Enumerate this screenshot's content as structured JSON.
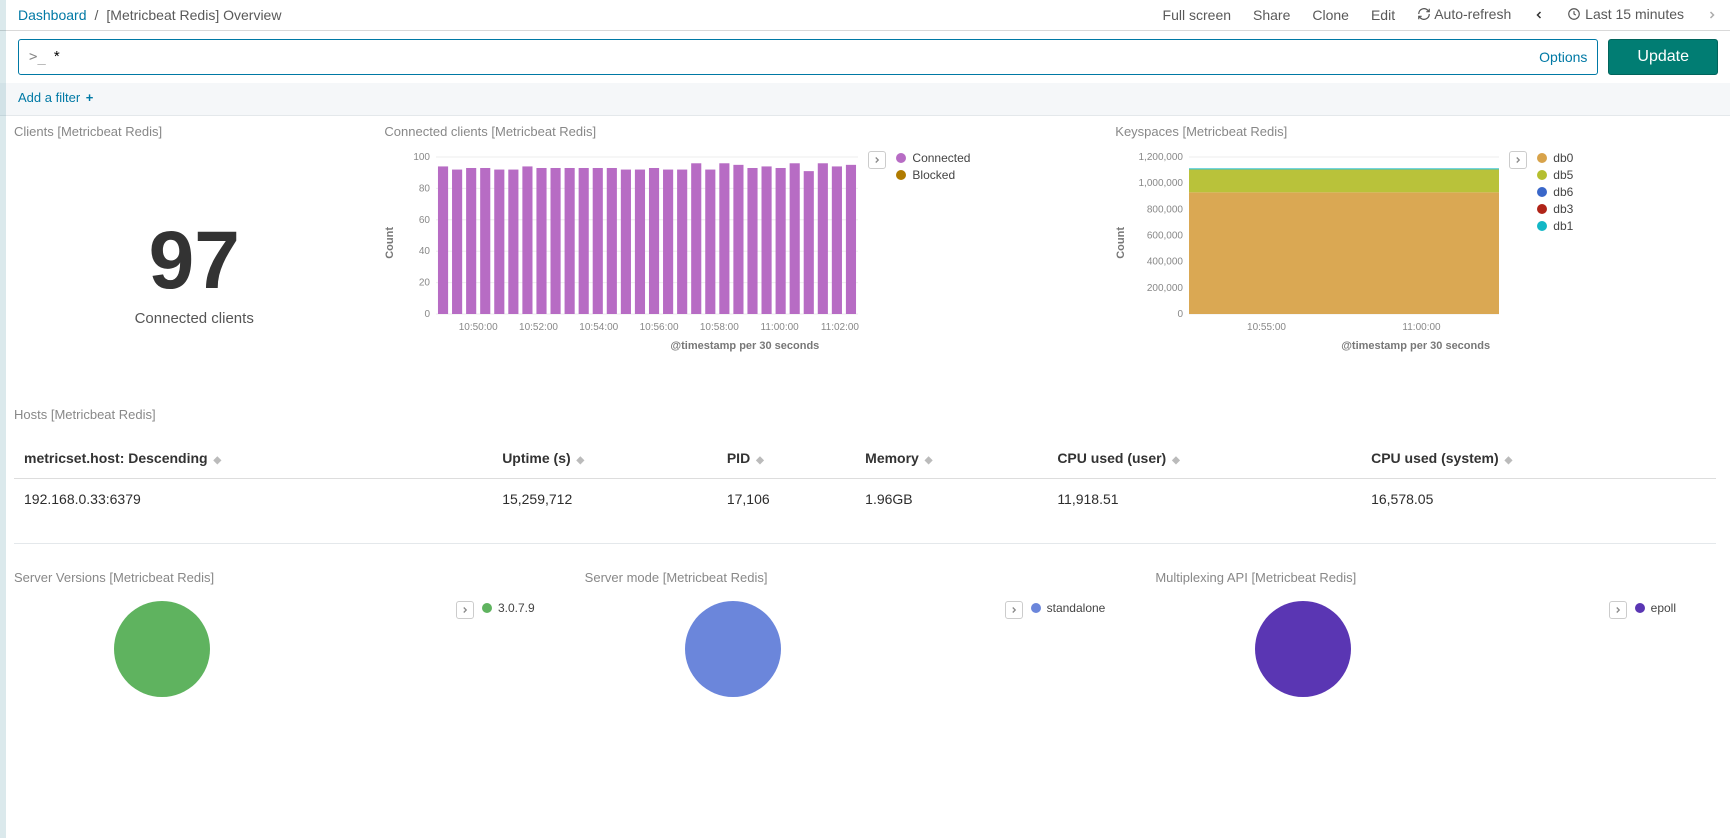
{
  "breadcrumb": {
    "root": "Dashboard",
    "sep": "/",
    "page": "[Metricbeat Redis] Overview"
  },
  "top_actions": {
    "full_screen": "Full screen",
    "share": "Share",
    "clone": "Clone",
    "edit": "Edit",
    "auto_refresh": "Auto-refresh",
    "time_range": "Last 15 minutes"
  },
  "query": {
    "prompt": ">_",
    "value": "*",
    "options": "Options",
    "update": "Update"
  },
  "filter_bar": {
    "add_filter": "Add a filter"
  },
  "panels": {
    "clients_metric": {
      "title": "Clients [Metricbeat Redis]",
      "value": "97",
      "label": "Connected clients"
    },
    "connected_clients": {
      "title": "Connected clients [Metricbeat Redis]",
      "ylabel": "Count",
      "xlabel": "@timestamp per 30 seconds",
      "legend": [
        "Connected",
        "Blocked"
      ],
      "legend_colors": [
        "#b76cc4",
        "#b07b00"
      ]
    },
    "keyspaces": {
      "title": "Keyspaces [Metricbeat Redis]",
      "ylabel": "Count",
      "xlabel": "@timestamp per 30 seconds",
      "legend": [
        "db0",
        "db5",
        "db6",
        "db3",
        "db1"
      ],
      "legend_colors": [
        "#d8a34a",
        "#b5bf2f",
        "#3a67c9",
        "#b02418",
        "#13b7c6"
      ]
    },
    "hosts": {
      "title": "Hosts [Metricbeat Redis]",
      "columns": [
        "metricset.host: Descending",
        "Uptime (s)",
        "PID",
        "Memory",
        "CPU used (user)",
        "CPU used (system)"
      ],
      "rows": [
        [
          "192.168.0.33:6379",
          "15,259,712",
          "17,106",
          "1.96GB",
          "11,918.51",
          "16,578.05"
        ]
      ]
    },
    "server_versions": {
      "title": "Server Versions [Metricbeat Redis]",
      "legend": [
        "3.0.7.9"
      ],
      "legend_colors": [
        "#5fb35f"
      ],
      "pie_color": "#5fb35f"
    },
    "server_mode": {
      "title": "Server mode [Metricbeat Redis]",
      "legend": [
        "standalone"
      ],
      "legend_colors": [
        "#6b86db"
      ],
      "pie_color": "#6b86db"
    },
    "multiplexing": {
      "title": "Multiplexing API [Metricbeat Redis]",
      "legend": [
        "epoll"
      ],
      "legend_colors": [
        "#5a36b3"
      ],
      "pie_color": "#5a36b3"
    }
  },
  "chart_data": [
    {
      "id": "connected_clients",
      "type": "bar",
      "title": "Connected clients [Metricbeat Redis]",
      "xlabel": "@timestamp per 30 seconds",
      "ylabel": "Count",
      "ylim": [
        0,
        100
      ],
      "yticks": [
        0,
        20,
        40,
        60,
        80,
        100
      ],
      "categories": [
        "10:48:30",
        "10:49:00",
        "10:49:30",
        "10:50:00",
        "10:50:30",
        "10:51:00",
        "10:51:30",
        "10:52:00",
        "10:52:30",
        "10:53:00",
        "10:53:30",
        "10:54:00",
        "10:54:30",
        "10:55:00",
        "10:55:30",
        "10:56:00",
        "10:56:30",
        "10:57:00",
        "10:57:30",
        "10:58:00",
        "10:58:30",
        "10:59:00",
        "10:59:30",
        "11:00:00",
        "11:00:30",
        "11:01:00",
        "11:01:30",
        "11:02:00",
        "11:02:30",
        "11:03:00"
      ],
      "xtick_labels": [
        "10:50:00",
        "10:52:00",
        "10:54:00",
        "10:56:00",
        "10:58:00",
        "11:00:00",
        "11:02:00"
      ],
      "series": [
        {
          "name": "Connected",
          "color": "#b76cc4",
          "values": [
            94,
            92,
            93,
            93,
            92,
            92,
            94,
            93,
            93,
            93,
            93,
            93,
            93,
            92,
            92,
            93,
            92,
            92,
            96,
            92,
            96,
            95,
            93,
            94,
            93,
            96,
            91,
            96,
            94,
            95
          ]
        },
        {
          "name": "Blocked",
          "color": "#b07b00",
          "values": [
            0,
            0,
            0,
            0,
            0,
            0,
            0,
            0,
            0,
            0,
            0,
            0,
            0,
            0,
            0,
            0,
            0,
            0,
            0,
            0,
            0,
            0,
            0,
            0,
            0,
            0,
            0,
            0,
            0,
            0
          ]
        }
      ],
      "legend_position": "right"
    },
    {
      "id": "keyspaces",
      "type": "area",
      "title": "Keyspaces [Metricbeat Redis]",
      "xlabel": "@timestamp per 30 seconds",
      "ylabel": "Count",
      "ylim": [
        0,
        1200000
      ],
      "yticks": [
        0,
        200000,
        400000,
        600000,
        800000,
        1000000,
        1200000
      ],
      "xtick_labels": [
        "10:55:00",
        "11:00:00"
      ],
      "x_range": [
        "10:48:30",
        "11:03:00"
      ],
      "series": [
        {
          "name": "db0",
          "color": "#d8a34a",
          "const_value": 930000
        },
        {
          "name": "db5",
          "color": "#b5bf2f",
          "const_value": 175000
        },
        {
          "name": "db6",
          "color": "#3a67c9",
          "const_value": 0
        },
        {
          "name": "db3",
          "color": "#b02418",
          "const_value": 0
        },
        {
          "name": "db1",
          "color": "#13b7c6",
          "const_value": 8000
        }
      ],
      "legend_position": "right"
    },
    {
      "id": "server_versions",
      "type": "pie",
      "title": "Server Versions [Metricbeat Redis]",
      "series": [
        {
          "name": "3.0.7.9",
          "value": 1,
          "color": "#5fb35f"
        }
      ]
    },
    {
      "id": "server_mode",
      "type": "pie",
      "title": "Server mode [Metricbeat Redis]",
      "series": [
        {
          "name": "standalone",
          "value": 1,
          "color": "#6b86db"
        }
      ]
    },
    {
      "id": "multiplexing_api",
      "type": "pie",
      "title": "Multiplexing API [Metricbeat Redis]",
      "series": [
        {
          "name": "epoll",
          "value": 1,
          "color": "#5a36b3"
        }
      ]
    }
  ]
}
